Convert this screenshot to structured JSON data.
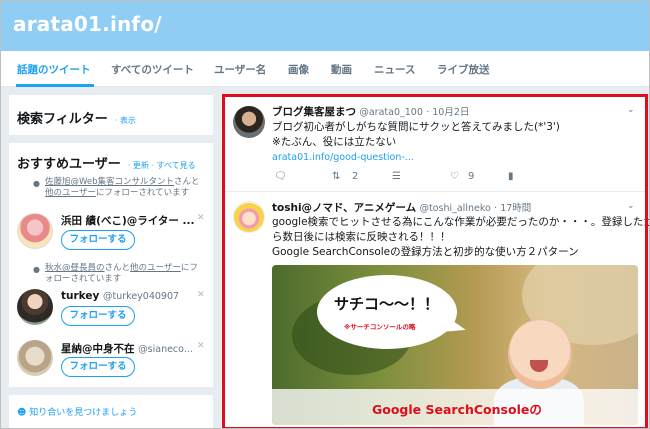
{
  "site": {
    "title": "arata01.info/"
  },
  "tabs": [
    {
      "label": "話題のツイート",
      "active": true
    },
    {
      "label": "すべてのツイート"
    },
    {
      "label": "ユーザー名"
    },
    {
      "label": "画像"
    },
    {
      "label": "動画"
    },
    {
      "label": "ニュース"
    },
    {
      "label": "ライブ放送"
    }
  ],
  "sidebar": {
    "filter_title": "検索フィルター",
    "filter_link": "· 表示",
    "rec_title": "おすすめユーザー",
    "rec_links": "· 更新 · すべて見る",
    "users": [
      {
        "context_parts": [
          "佐藤旭@Web集客コンサルタント",
          "さんと",
          "他のユーザー",
          "にフォローされています"
        ],
        "name": "浜田 績(べこ)@ライター ...",
        "handle": "",
        "follow_label": "フォローする"
      },
      {
        "context_parts": [
          "秋水@昼長員の",
          "さんと",
          "他のユーザー",
          "にフォローされています"
        ],
        "name": "turkey",
        "handle": "@turkey040907",
        "follow_label": "フォローする"
      },
      {
        "context_parts": [],
        "name": "星納@中身不在",
        "handle": "@sianeco...",
        "follow_label": "フォローする"
      }
    ],
    "find_friends": "知り合いを見つけましょう"
  },
  "tweets": [
    {
      "name": "ブログ集客屋まつ",
      "handle": "@arata0_100",
      "time": "· 10月2日",
      "lines": [
        "ブログ初心者がしがちな質問にサクッと答えてみました(*'3')",
        "※たぶん、役には立たない"
      ],
      "link": "arata01.info/good-question-...",
      "actions": {
        "retweets": "2",
        "likes": "9"
      }
    },
    {
      "name": "toshi@ノマド、アニメゲーム",
      "handle": "@toshi_allneko",
      "time": "· 17時間",
      "lines": [
        "google検索でヒットさせる為にこんな作業が必要だったのか・・・。登録したか",
        "ら数日後には検索に反映される！！！",
        "Google SearchConsoleの登録方法と初步的な使い方２パターン"
      ],
      "media": {
        "bubble_main": "サチコ～～！！",
        "bubble_sub": "※サーチコンソールの略",
        "banner": "Google SearchConsoleの"
      }
    }
  ],
  "colors": {
    "header": "#8fcdf4",
    "accent": "#1da1f2",
    "highlight": "#e00b1b"
  },
  "icons": [
    "person-icon",
    "close-icon",
    "chevron-down-icon",
    "reply-icon",
    "retweet-icon",
    "stack-icon",
    "heart-icon",
    "analytics-icon",
    "people-icon"
  ]
}
